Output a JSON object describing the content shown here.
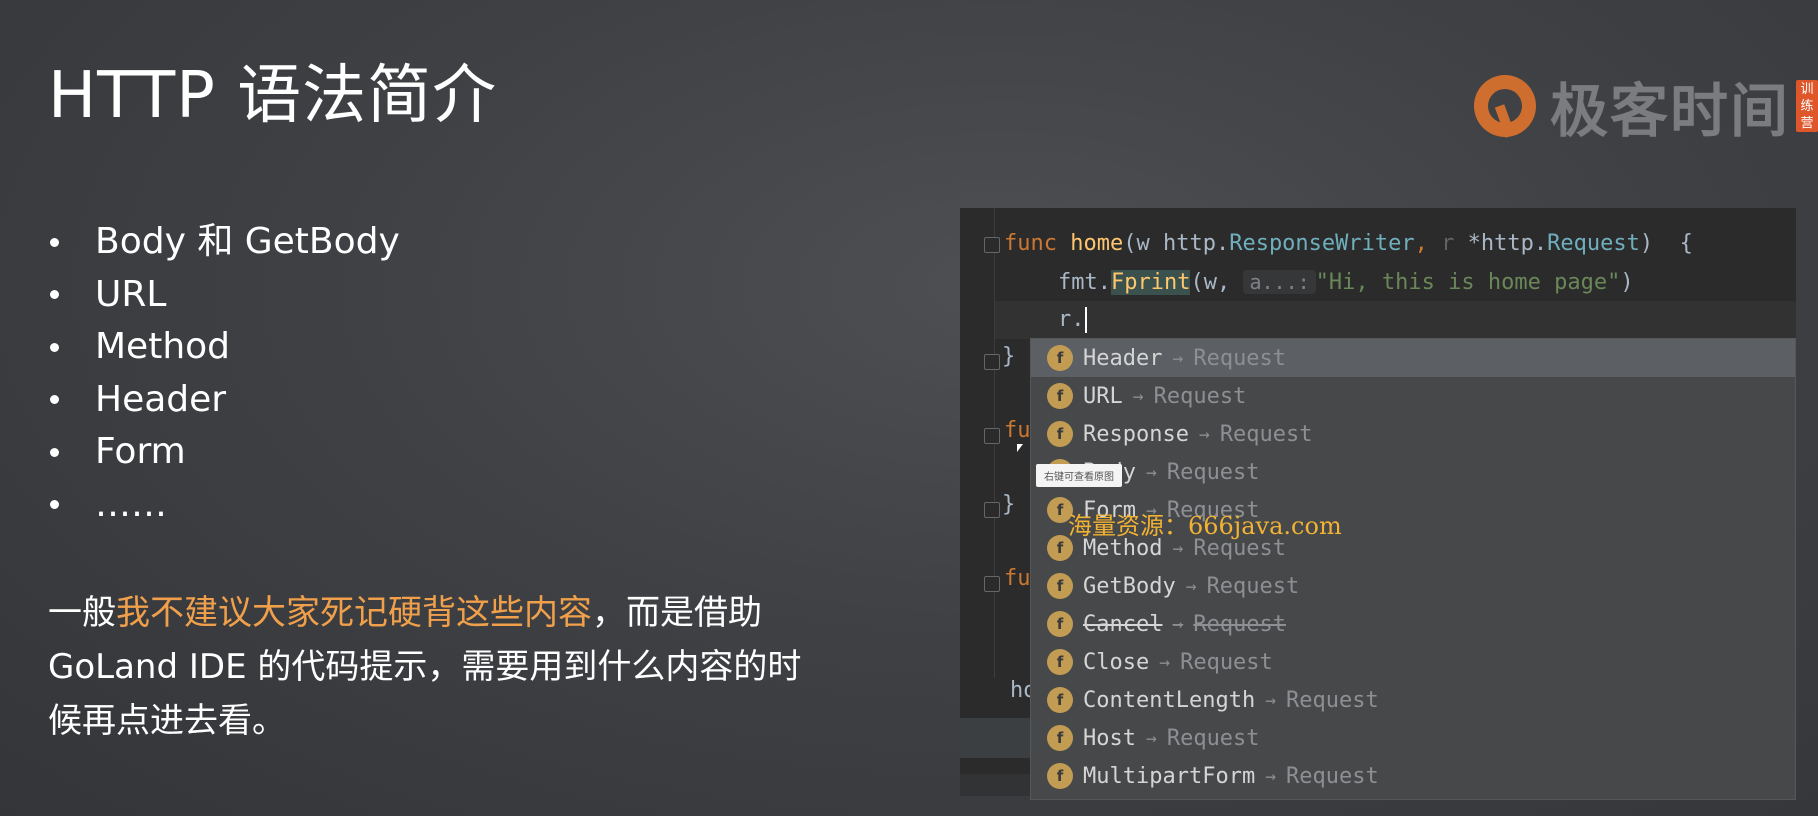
{
  "slide": {
    "title": "HTTP 语法简介",
    "bullets": [
      "Body 和 GetBody",
      "URL",
      "Method",
      "Header",
      "Form",
      "……"
    ],
    "paragraph": {
      "pre": "一般",
      "accent": "我不建议大家死记硬背这些内容",
      "post": "，而是借助 GoLand IDE 的代码提示，需要用到什么内容的时候再点进去看。"
    },
    "accent_color": "#f0a04b"
  },
  "brand": {
    "name": "极客时间",
    "badge": [
      "训",
      "练",
      "营"
    ],
    "color": "#e8762b"
  },
  "editor": {
    "line1": {
      "kw": "func",
      "fn": "home",
      "p1": "(w ",
      "pkg1": "http.",
      "typ1": "ResponseWriter",
      "sep": ", ",
      "pname": "r",
      "star": " *",
      "pkg2": "http.",
      "typ2": "Request",
      "end": ")  {"
    },
    "line2": {
      "pre": "fmt.",
      "fn": "Fprint",
      "open": "(w, ",
      "hint": "a...:",
      "str": "\"Hi, this is home page\"",
      "close": ")"
    },
    "line3": "r.",
    "brace": "}",
    "partial": "fu",
    "ho": "ho"
  },
  "completion": {
    "items": [
      {
        "name": "Header",
        "type": "Request",
        "selected": true
      },
      {
        "name": "URL",
        "type": "Request"
      },
      {
        "name": "Response",
        "type": "Request"
      },
      {
        "name": "Body",
        "type": "Request"
      },
      {
        "name": "Form",
        "type": "Request"
      },
      {
        "name": "Method",
        "type": "Request"
      },
      {
        "name": "GetBody",
        "type": "Request"
      },
      {
        "name": "Cancel",
        "type": "Request",
        "deprecated": true
      },
      {
        "name": "Close",
        "type": "Request"
      },
      {
        "name": "ContentLength",
        "type": "Request"
      },
      {
        "name": "Host",
        "type": "Request"
      },
      {
        "name": "MultipartForm",
        "type": "Request"
      }
    ],
    "badge_letter": "f",
    "arrow": "→"
  },
  "tooltip": "右键可查看原图",
  "watermark": "海量资源：666java.com"
}
